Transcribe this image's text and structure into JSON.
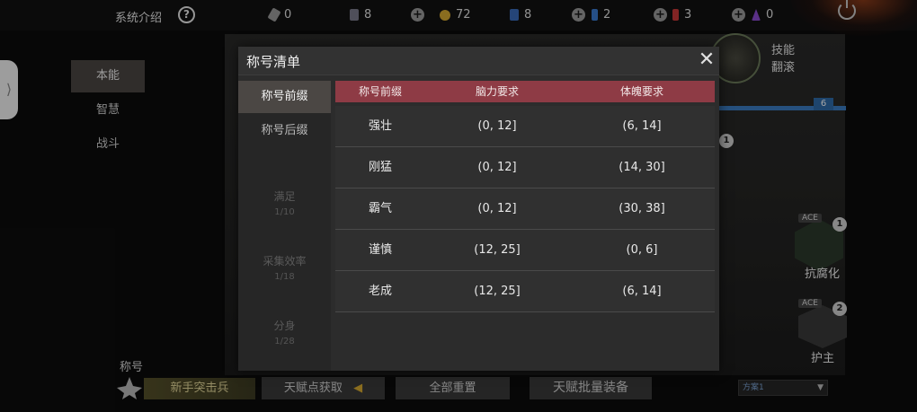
{
  "topbar": {
    "intro": "系统介绍",
    "resources": [
      {
        "icon": "bandage-icon",
        "value": "0",
        "color": "#9a9a9a"
      },
      {
        "icon": "notebook-icon",
        "value": "8",
        "color": "#7a7a8a"
      },
      {
        "icon": "gold-coin-icon",
        "value": "72",
        "color": "#d4a830"
      },
      {
        "icon": "blue-card-icon",
        "value": "8",
        "color": "#3a6ab8"
      },
      {
        "icon": "blue-potion-icon",
        "value": "2",
        "color": "#3a7ad0"
      },
      {
        "icon": "red-potion-icon",
        "value": "3",
        "color": "#c83838"
      },
      {
        "icon": "purple-crystal-icon",
        "value": "0",
        "color": "#8a4ad0"
      }
    ]
  },
  "leftnav": {
    "items": [
      "本能",
      "智慧",
      "战斗"
    ],
    "active": 0
  },
  "background": {
    "skill_label_1": "技能",
    "skill_label_2": "翻滚",
    "bluebar_value": "6",
    "side_skills": [
      {
        "ace": "ACE",
        "badge": "1",
        "name": "抗腐化"
      },
      {
        "ace": "ACE",
        "badge": "2",
        "name": "护主"
      }
    ],
    "badge_mid": "1"
  },
  "bottom": {
    "title_label": "称号",
    "rank": "新手突击兵",
    "talent_source": "天赋点获取",
    "reset_all": "全部重置",
    "batch_equip": "天赋批量装备",
    "scheme": "方案1"
  },
  "modal": {
    "title": "称号清单",
    "tabs": [
      "称号前缀",
      "称号后缀"
    ],
    "active_tab": 0,
    "ghost_items": [
      {
        "name": "满足",
        "sub": "1/10"
      },
      {
        "name": "采集效率",
        "sub": "1/18"
      },
      {
        "name": "分身",
        "sub": "1/28"
      }
    ],
    "table": {
      "headers": [
        "称号前缀",
        "脑力要求",
        "体魄要求"
      ],
      "header_color": "#8e3b45",
      "rows": [
        [
          "强壮",
          "(0, 12]",
          "(6, 14]"
        ],
        [
          "刚猛",
          "(0, 12]",
          "(14, 30]"
        ],
        [
          "霸气",
          "(0, 12]",
          "(30, 38]"
        ],
        [
          "谨慎",
          "(12, 25]",
          "(0, 6]"
        ],
        [
          "老成",
          "(12, 25]",
          "(6, 14]"
        ]
      ]
    }
  }
}
